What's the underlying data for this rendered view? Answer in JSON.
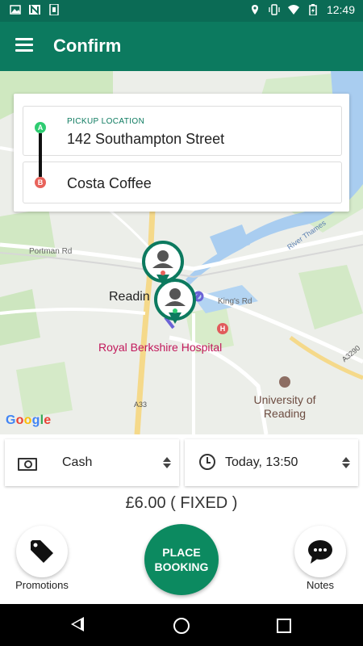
{
  "status_bar": {
    "time": "12:49",
    "left_icons": [
      "image-icon",
      "n-icon",
      "sim-icon"
    ],
    "right_icons": [
      "location-icon",
      "vibrate-icon",
      "wifi-icon",
      "battery-icon"
    ]
  },
  "app_bar": {
    "title": "Confirm",
    "menu_icon": "hamburger-menu-icon"
  },
  "route": {
    "pickup": {
      "marker": "A",
      "caption": "PICKUP LOCATION",
      "address": "142 Southampton Street"
    },
    "dropoff": {
      "marker": "B",
      "address": "Costa Coffee"
    }
  },
  "map": {
    "labels": {
      "portman": "Portman Rd",
      "reading": "Readin",
      "kings": "King's Rd",
      "hospital": "Royal Berkshire Hospital",
      "university": "University of Reading",
      "a33": "A33",
      "a3290": "A3290",
      "river": "River Thames",
      "hospital_marker": "H"
    },
    "attribution": "Google"
  },
  "payment": {
    "value": "Cash",
    "icon": "cash-icon"
  },
  "time": {
    "value": "Today, 13:50",
    "icon": "clock-icon"
  },
  "price": "£6.00 ( FIXED )",
  "actions": {
    "promotions": "Promotions",
    "place_booking": "PLACE\nBOOKING",
    "notes": "Notes"
  },
  "colors": {
    "primary": "#0c7a5f",
    "status_bar": "#0b6b55",
    "pickup": "#2ecc71",
    "dropoff": "#e8635b"
  }
}
